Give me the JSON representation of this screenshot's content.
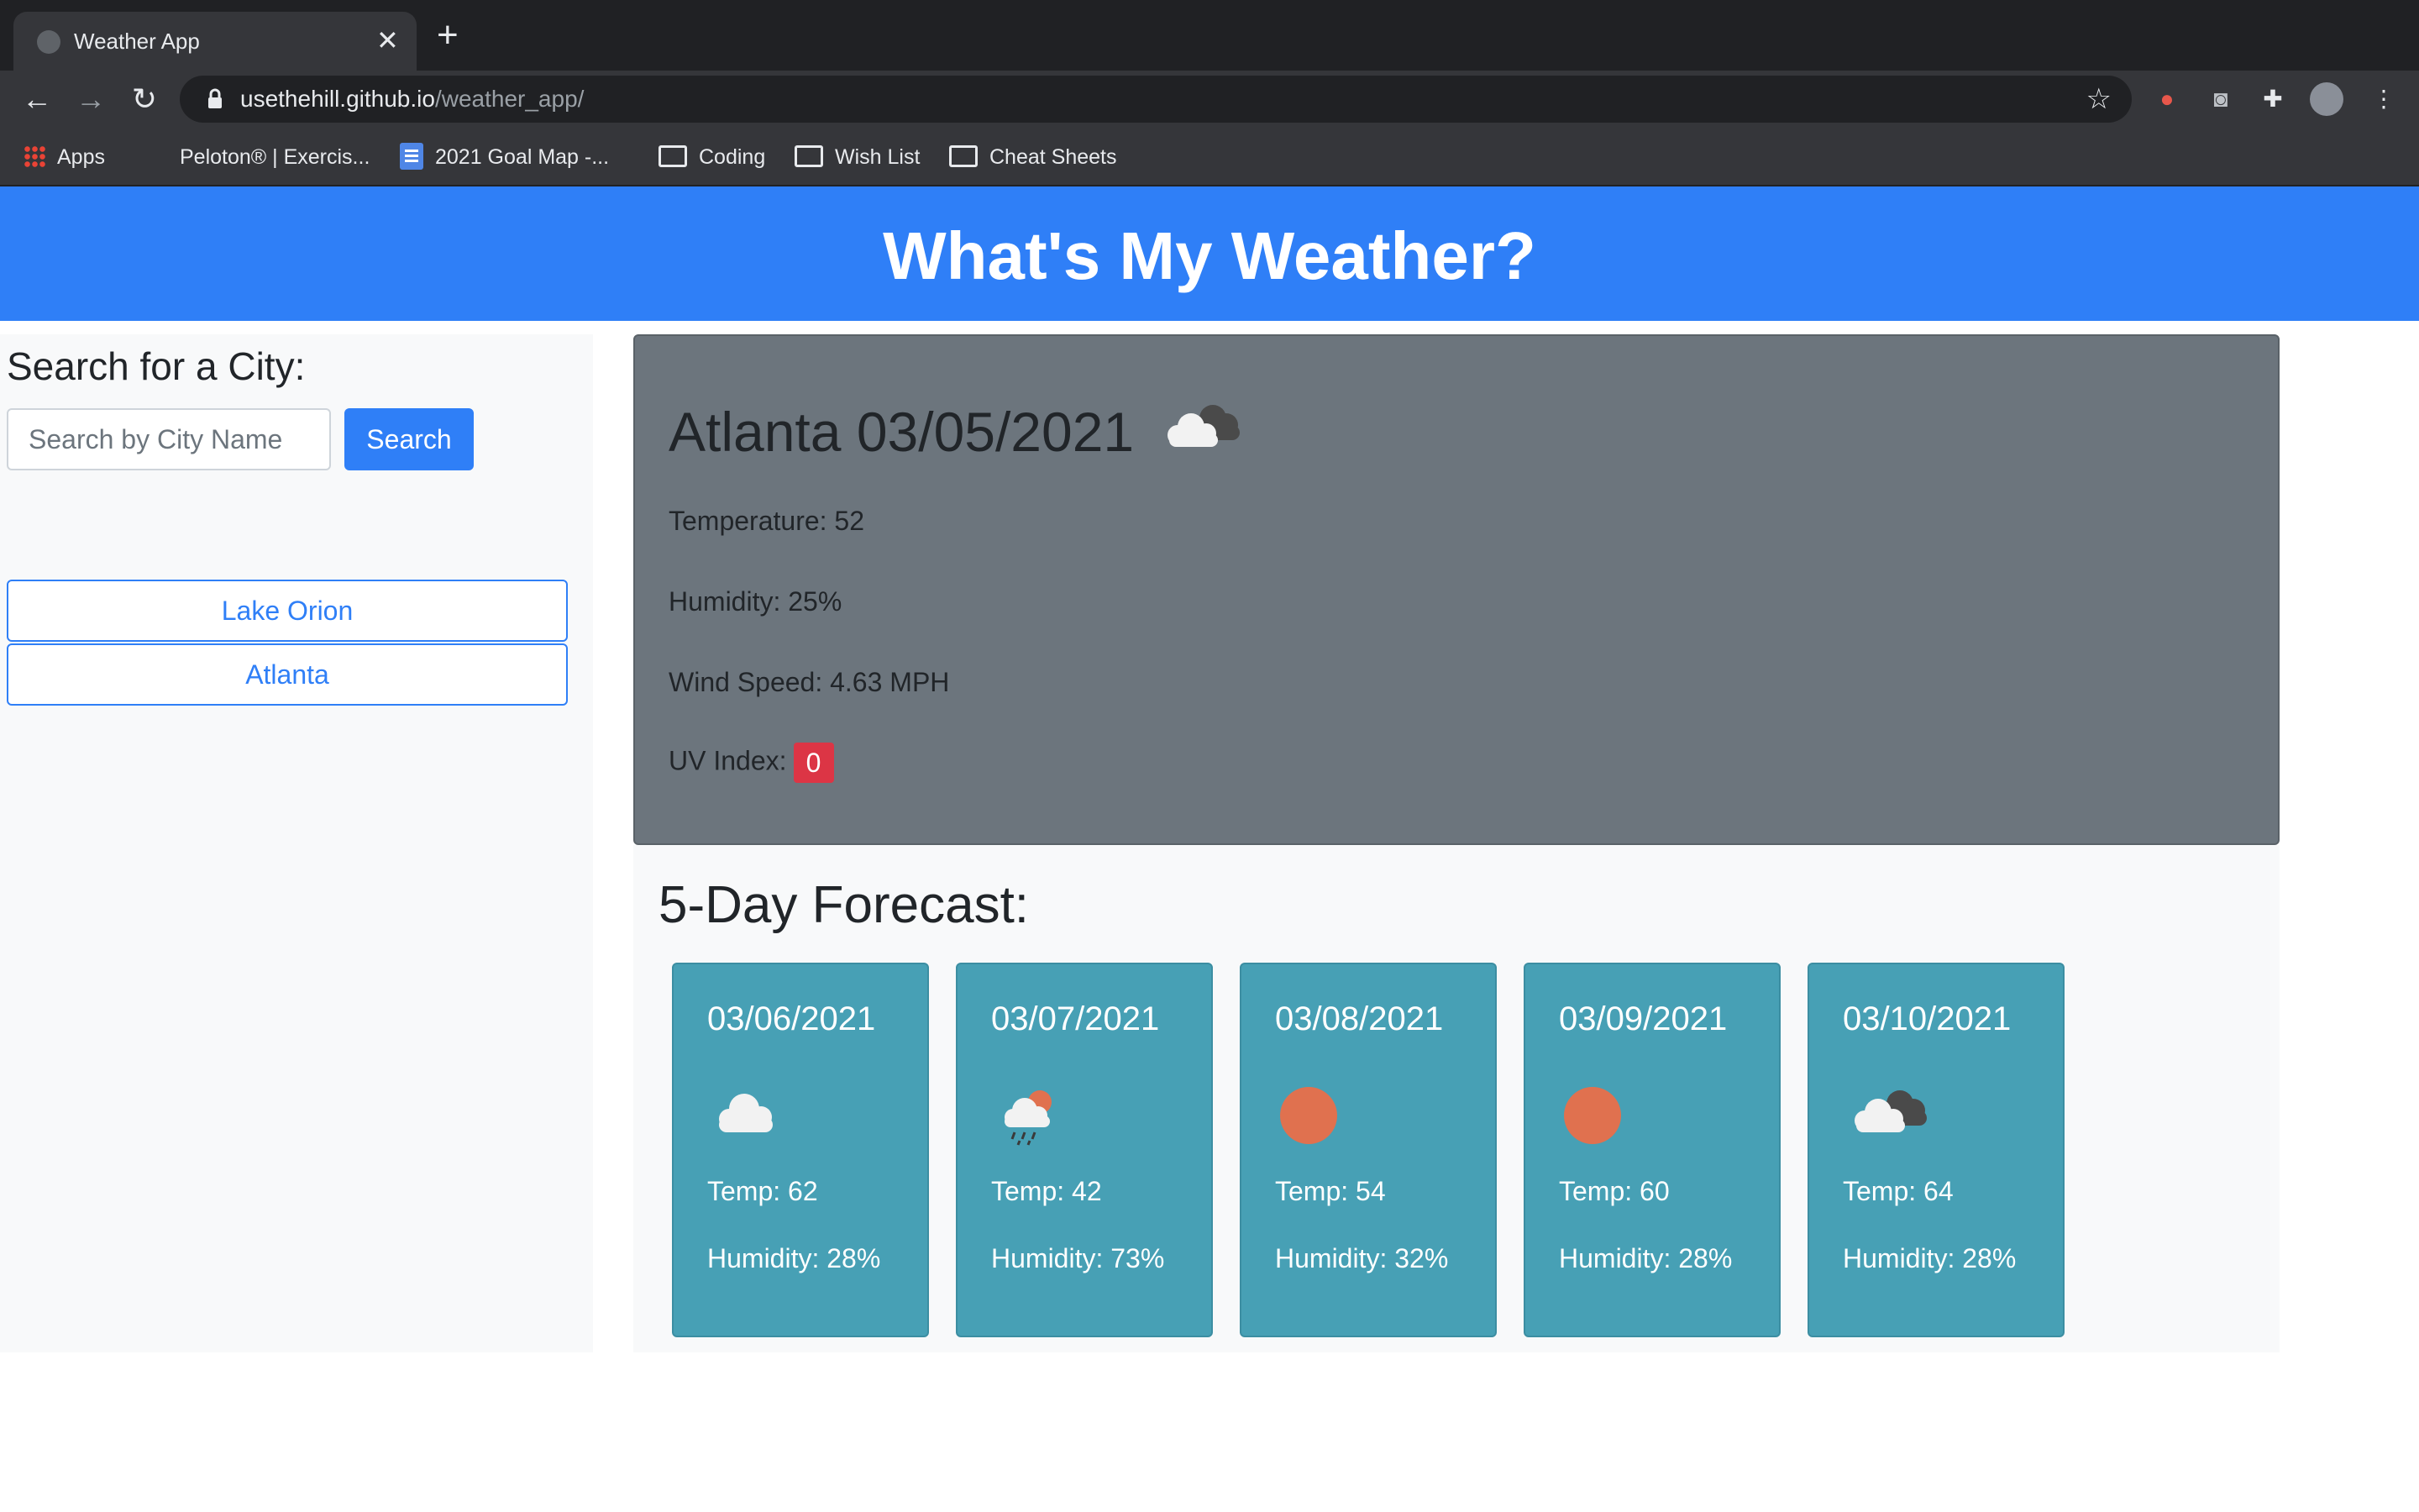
{
  "browser": {
    "tab_title": "Weather App",
    "new_tab_label": "+",
    "tab_close_label": "✕",
    "url_host": "usethehill.github.io",
    "url_path": "/weather_app/",
    "bookmarks": [
      {
        "label": "Apps",
        "icon": "apps-icon"
      },
      {
        "label": "Peloton® | Exercis...",
        "icon": "peloton-icon"
      },
      {
        "label": "2021 Goal Map -...",
        "icon": "doc-icon"
      },
      {
        "label": "Coding",
        "icon": "folder-icon"
      },
      {
        "label": "Wish List",
        "icon": "folder-icon"
      },
      {
        "label": "Cheat Sheets",
        "icon": "folder-icon"
      }
    ]
  },
  "header": {
    "title": "What's My Weather?"
  },
  "sidebar": {
    "heading": "Search for a City:",
    "search_placeholder": "Search by City Name",
    "search_button": "Search",
    "history": [
      "Lake Orion",
      "Atlanta"
    ]
  },
  "current": {
    "heading": "Atlanta 03/05/2021",
    "icon": "broken-clouds-icon",
    "temperature": "Temperature: 52",
    "humidity": "Humidity: 25%",
    "wind": "Wind Speed: 4.63 MPH",
    "uv_label": "UV Index:",
    "uv_value": "0",
    "uv_color": "#dc3545"
  },
  "forecast": {
    "heading": "5-Day Forecast:",
    "days": [
      {
        "date": "03/06/2021",
        "icon": "cloud-icon",
        "temp": "Temp: 62",
        "humidity": "Humidity: 28%"
      },
      {
        "date": "03/07/2021",
        "icon": "rain-sun-icon",
        "temp": "Temp: 42",
        "humidity": "Humidity: 73%"
      },
      {
        "date": "03/08/2021",
        "icon": "sun-icon",
        "temp": "Temp: 54",
        "humidity": "Humidity: 32%"
      },
      {
        "date": "03/09/2021",
        "icon": "sun-icon",
        "temp": "Temp: 60",
        "humidity": "Humidity: 28%"
      },
      {
        "date": "03/10/2021",
        "icon": "broken-clouds-icon",
        "temp": "Temp: 64",
        "humidity": "Humidity: 28%"
      }
    ]
  },
  "colors": {
    "header": "#2f7ff7",
    "primary": "#2f7ff7",
    "current_panel": "#6c757d",
    "card": "#47a0b5",
    "sun": "#e0714f"
  }
}
